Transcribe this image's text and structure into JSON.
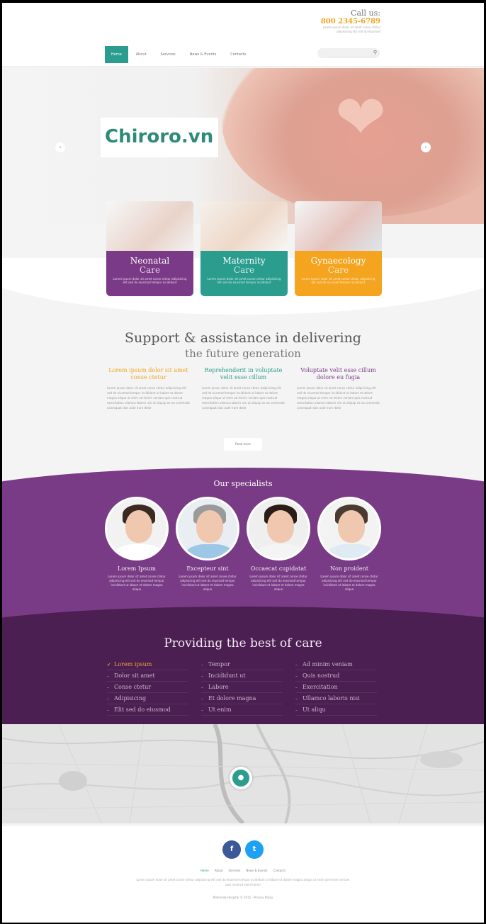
{
  "header": {
    "call_label": "Call us:",
    "phone": "800 2345-6789",
    "small_text": "Lorem ipsum dolor sit amet conse ctetur adipisicing elit sed do eiusmod"
  },
  "nav": {
    "items": [
      "Home",
      "About",
      "Services",
      "News & Events",
      "Contacts"
    ],
    "active_index": 0
  },
  "hero": {
    "watermark": "Chiroro.vn",
    "prev_glyph": "‹",
    "next_glyph": "›"
  },
  "cards": [
    {
      "title1": "Neonatal",
      "title2": "Care",
      "color": "#7b3a87",
      "text": "Lorem ipsum dolor sit amet conse ctetur adipisicing elit sed do eiusmod tempor incididunt"
    },
    {
      "title1": "Maternity",
      "title2": "Care",
      "color": "#2a9d8f",
      "text": "Lorem ipsum dolor sit amet conse ctetur adipisicing elit sed do eiusmod tempor incididunt"
    },
    {
      "title1": "Gynaecology",
      "title2": "Care",
      "color": "#f4a41f",
      "text": "Lorem ipsum dolor sit amet conse ctetur adipisicing elit sed do eiusmod tempor incididunt"
    }
  ],
  "support": {
    "title": "Support & assistance in delivering",
    "subtitle": "the future generation",
    "columns": [
      {
        "heading": "Lorem ipsum dolor sit amet conse ctetur",
        "color": "#f4a41f",
        "text": "Lorem ipsum dolor sit amet conse ctetur adipisicing elit sed do eiusmod tempor incididunt ut labore et dolore magna aliqua ut enim ad minim veniam quis nostrud exercitation ullamco laboris nisi ut aliquip ex ea commodo consequat duis aute irure dolor"
      },
      {
        "heading": "Reprehenderit in voluptate velit esse cillum",
        "color": "#2a9d8f",
        "text": "Lorem ipsum dolor sit amet conse ctetur adipisicing elit sed do eiusmod tempor incididunt ut labore et dolore magna aliqua ut enim ad minim veniam quis nostrud exercitation ullamco laboris nisi ut aliquip ex ea commodo consequat duis aute irure dolor"
      },
      {
        "heading": "Voluptate velit esse cillum dolore eu fugia",
        "color": "#7b3a87",
        "text": "Lorem ipsum dolor sit amet conse ctetur adipisicing elit sed do eiusmod tempor incididunt ut labore et dolore magna aliqua ut enim ad minim veniam quis nostrud exercitation ullamco laboris nisi ut aliquip ex ea commodo consequat duis aute irure dolor"
      }
    ],
    "button": "Read more"
  },
  "specialists": {
    "title": "Our specialists",
    "people": [
      {
        "name": "Lorem Ipsum",
        "text": "Lorem ipsum dolor sit amet conse ctetur adipisicing elit sed do eiusmod tempor incididunt ut labore et dolore magna aliqua"
      },
      {
        "name": "Excepteur sint",
        "text": "Lorem ipsum dolor sit amet conse ctetur adipisicing elit sed do eiusmod tempor incididunt ut labore et dolore magna aliqua"
      },
      {
        "name": "Occaecat cupidatat",
        "text": "Lorem ipsum dolor sit amet conse ctetur adipisicing elit sed do eiusmod tempor incididunt ut labore et dolore magna aliqua"
      },
      {
        "name": "Non proident",
        "text": "Lorem ipsum dolor sit amet conse ctetur adipisicing elit sed do eiusmod tempor incididunt ut labore et dolore magna aliqua"
      }
    ]
  },
  "care": {
    "title": "Providing the best of care",
    "columns": [
      [
        "Lorem ipsum",
        "Dolor sit amet",
        "Conse ctetur",
        "Adipisicing",
        "Elit sed do eiusmod"
      ],
      [
        "Tempor",
        "Incididunt ut",
        "Labore",
        "Et dolore magna",
        "Ut enim"
      ],
      [
        "Ad minim veniam",
        "Quis nostrud",
        "Exercitation",
        "Ullamco laboris nisi",
        "Ut aliqu"
      ]
    ]
  },
  "footer": {
    "facebook": "f",
    "twitter": "t",
    "links": [
      "Home",
      "About",
      "Services",
      "News & Events",
      "Contacts"
    ],
    "text": "Lorem ipsum dolor sit amet conse ctetur adipisicing elit sed do eiusmod tempor incididunt ut labore et dolore magna aliqua ut enim ad minim veniam quis nostrud exercitation",
    "copyright": "Maternity Hospital © 2015 · Privacy Policy"
  },
  "colors": {
    "teal": "#2a9d8f",
    "purple": "#7b3a87",
    "dark_purple": "#4c1f52",
    "orange": "#f4a41f",
    "facebook": "#3b5998",
    "twitter": "#1da1f2"
  }
}
